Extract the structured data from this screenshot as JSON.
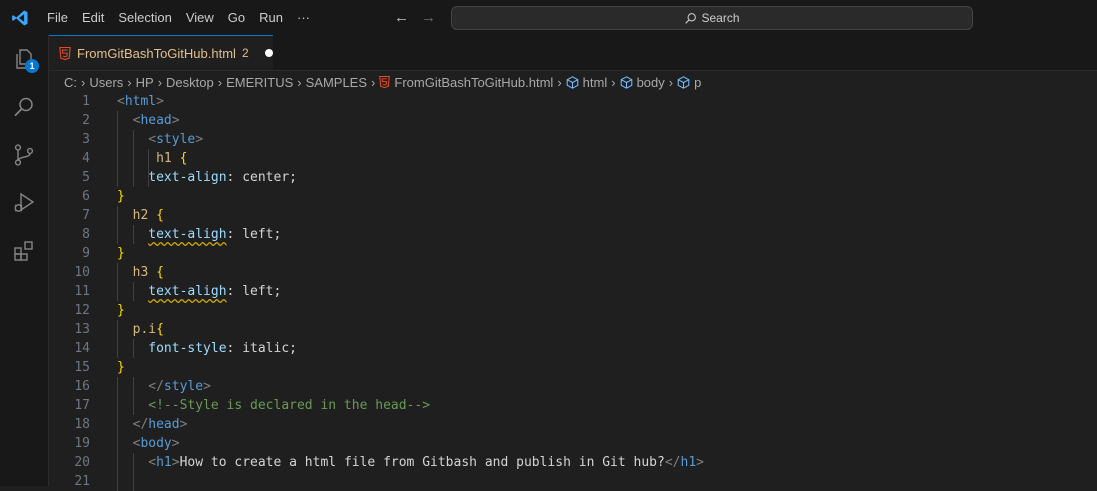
{
  "titlebar": {
    "menu": [
      "File",
      "Edit",
      "Selection",
      "View",
      "Go",
      "Run",
      "···"
    ],
    "search_placeholder": "Search",
    "nav_back_icon": "arrow-left-icon",
    "nav_forward_icon": "arrow-right-icon"
  },
  "activitybar": {
    "explorer_badge": "1",
    "icons": [
      "explorer-icon",
      "search-icon",
      "source-control-icon",
      "run-debug-icon",
      "extensions-icon"
    ]
  },
  "tab": {
    "filename": "FromGitBashToGitHub.html",
    "problems": "2",
    "icon": "html5-icon",
    "modified": true
  },
  "breadcrumb": {
    "path": [
      "C:",
      "Users",
      "HP",
      "Desktop",
      "EMERITUS",
      "SAMPLES"
    ],
    "file": "FromGitBashToGitHub.html",
    "symbols": [
      "html",
      "body",
      "p"
    ]
  },
  "editor": {
    "lines": [
      {
        "n": "1",
        "tokens": [
          [
            "br",
            "<"
          ],
          [
            "tag",
            "html"
          ],
          [
            "br",
            ">"
          ]
        ]
      },
      {
        "n": "2",
        "tokens": [
          [
            "br",
            "<"
          ],
          [
            "tag",
            "head"
          ],
          [
            "br",
            ">"
          ]
        ]
      },
      {
        "n": "3",
        "tokens": [
          [
            "br",
            "<"
          ],
          [
            "tag",
            "style"
          ],
          [
            "br",
            ">"
          ]
        ]
      },
      {
        "n": "4",
        "tokens": [
          [
            "sel",
            "h1 "
          ],
          [
            "brace",
            "{"
          ]
        ]
      },
      {
        "n": "5",
        "tokens": [
          [
            "prop",
            "text-align"
          ],
          [
            "text",
            ": center;"
          ]
        ]
      },
      {
        "n": "6",
        "tokens": [
          [
            "brace",
            "}"
          ]
        ]
      },
      {
        "n": "7",
        "tokens": [
          [
            "sel",
            "h2 "
          ],
          [
            "brace",
            "{"
          ]
        ]
      },
      {
        "n": "8",
        "tokens": [
          [
            "prop",
            "text-aligh",
            "squig"
          ],
          [
            "text",
            ": left;"
          ]
        ]
      },
      {
        "n": "9",
        "tokens": [
          [
            "brace",
            "}"
          ]
        ]
      },
      {
        "n": "10",
        "tokens": [
          [
            "sel",
            "h3 "
          ],
          [
            "brace",
            "{"
          ]
        ]
      },
      {
        "n": "11",
        "tokens": [
          [
            "prop",
            "text-aligh",
            "squig"
          ],
          [
            "text",
            ": left;"
          ]
        ]
      },
      {
        "n": "12",
        "tokens": [
          [
            "brace",
            "}"
          ]
        ]
      },
      {
        "n": "13",
        "tokens": [
          [
            "sel",
            "p.i"
          ],
          [
            "brace",
            "{"
          ]
        ]
      },
      {
        "n": "14",
        "tokens": [
          [
            "prop",
            "font-style"
          ],
          [
            "text",
            ": italic;"
          ]
        ]
      },
      {
        "n": "15",
        "tokens": [
          [
            "brace",
            "}"
          ]
        ]
      },
      {
        "n": "16",
        "tokens": [
          [
            "br",
            "</"
          ],
          [
            "tag",
            "style"
          ],
          [
            "br",
            ">"
          ]
        ]
      },
      {
        "n": "17",
        "tokens": [
          [
            "com",
            "<!--Style is declared in the head-->"
          ]
        ]
      },
      {
        "n": "18",
        "tokens": [
          [
            "br",
            "</"
          ],
          [
            "tag",
            "head"
          ],
          [
            "br",
            ">"
          ]
        ]
      },
      {
        "n": "19",
        "tokens": [
          [
            "br",
            "<"
          ],
          [
            "tag",
            "body"
          ],
          [
            "br",
            ">"
          ]
        ]
      },
      {
        "n": "20",
        "tokens": [
          [
            "br",
            "<"
          ],
          [
            "tag",
            "h1"
          ],
          [
            "br",
            ">"
          ],
          [
            "text",
            "How to create a html file from Gitbash and publish in Git hub?"
          ],
          [
            "br",
            "</"
          ],
          [
            "tag",
            "h1"
          ],
          [
            "br",
            ">"
          ]
        ]
      },
      {
        "n": "21",
        "tokens": []
      }
    ]
  },
  "colors": {
    "accent": "#0078d4",
    "tab_modified_text": "#e2c08d",
    "html_icon": "#e44d26",
    "symbol_icon": "#75beff"
  }
}
